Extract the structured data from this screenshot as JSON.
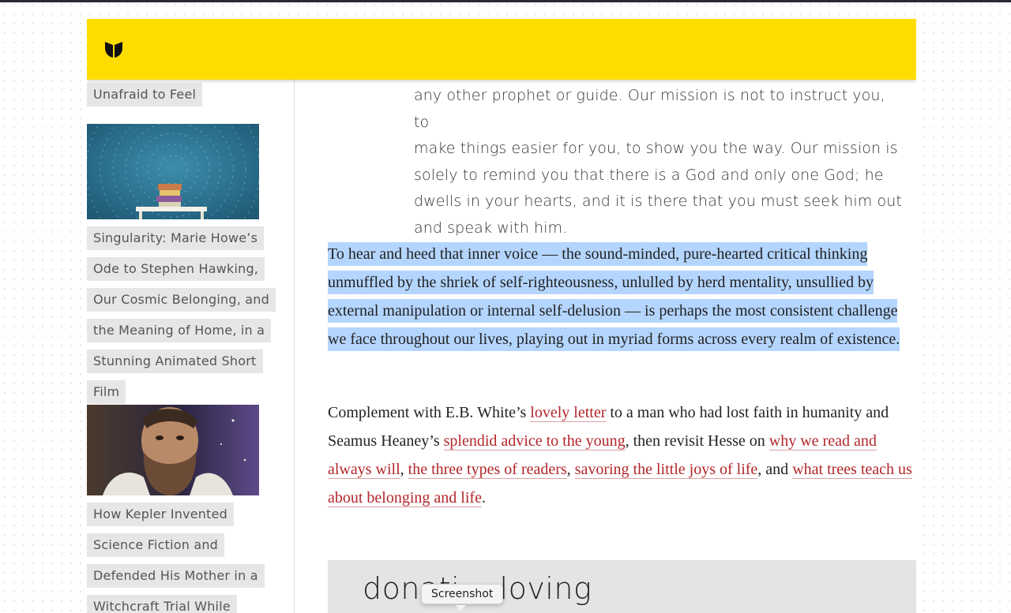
{
  "sidebar": {
    "prev_tail": "Unafraid to Feel",
    "articles": [
      {
        "image_desc": "books-under-starry-vortex",
        "title_lines": [
          "Singularity: Marie Howe’s",
          "Ode to Stephen Hawking,",
          "Our Cosmic Belonging, and",
          "the Meaning of Home, in a",
          "Stunning Animated Short",
          "Film"
        ]
      },
      {
        "image_desc": "kepler-portrait",
        "title_lines": [
          "How Kepler Invented",
          "Science Fiction and",
          "Defended His Mother in a",
          "Witchcraft Trial While"
        ]
      }
    ]
  },
  "article": {
    "quote_lines": [
      "any other prophet or guide. Our mission is not to instruct you, to",
      "make things easier for you, to show you the way. Our mission is",
      "solely to remind you that there is a God and only one God; he",
      "dwells in your hearts, and it is there that you must seek him out",
      "and speak with him."
    ],
    "highlighted_paragraph": "To hear and heed that inner voice — the sound-minded, pure-hearted critical thinking unmuffled by the shriek of self-righteousness, unlulled by herd mentality, unsullied by external manipulation or internal self-delusion — is perhaps the most consistent challenge we face throughout our lives, playing out in myriad forms across every realm of existence.",
    "complement": {
      "t1": "Complement with E.B. White’s ",
      "link1": "lovely letter",
      "t2": " to a man who had lost faith in humanity and Seamus Heaney’s ",
      "link2": "splendid advice to the young",
      "t3": ", then revisit Hesse on ",
      "link3": "why we read and always will",
      "t4": ", ",
      "link4": "the three types of readers",
      "t5": ", ",
      "link5": "savoring the little joys of life",
      "t6": ", and ",
      "link6": "what trees teach us about belonging and life",
      "t7": "."
    },
    "donate_text": "donati    loving"
  },
  "tooltip": {
    "label": "Screenshot"
  },
  "colors": {
    "header": "#ffdc00",
    "highlight": "#b4d5fe",
    "link": "#b3262a",
    "tag_bg": "#e6e6e6"
  },
  "icons": {
    "logo": "marginalian-logo-icon"
  }
}
